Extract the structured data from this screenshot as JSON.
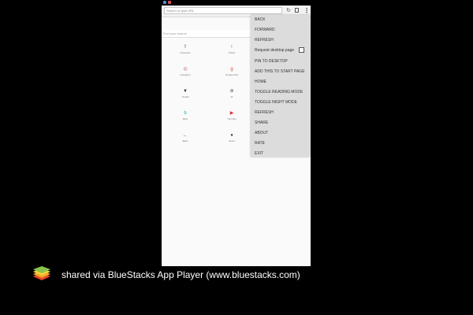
{
  "browser": {
    "url_placeholder": "Search or type URL",
    "search_placeholder": "Find your search",
    "icons": {
      "reload": "reload-icon",
      "tabs": "tabs-icon",
      "overflow": "overflow-menu-icon"
    }
  },
  "speed_dial": [
    {
      "icon": "facebook-icon",
      "label": "Facebook",
      "color": "#3b5998",
      "glyph": "f"
    },
    {
      "icon": "twitter-icon",
      "label": "Twitter",
      "color": "#55acee",
      "glyph": "t"
    },
    {
      "icon": "instagram-icon",
      "label": "Instagram",
      "color": "#c2507e",
      "glyph": "◎"
    },
    {
      "icon": "google-plus-icon",
      "label": "Google Plus",
      "color": "#dd4b39",
      "glyph": "g"
    },
    {
      "icon": "vivaldi-icon",
      "label": "Vivaldi",
      "color": "#333333",
      "glyph": "▼"
    },
    {
      "icon": "wikipedia-icon",
      "label": "W",
      "color": "#555555",
      "glyph": "⊛"
    },
    {
      "icon": "bing-icon",
      "label": "Bing",
      "color": "#2ba6a6",
      "glyph": "b"
    },
    {
      "icon": "youtube-icon",
      "label": "YouTube",
      "color": "#d9322f",
      "glyph": "▶"
    },
    {
      "icon": "back-arrow-icon",
      "label": "Back",
      "color": "#555555",
      "glyph": "←"
    },
    {
      "icon": "about-icon",
      "label": "About",
      "color": "#444444",
      "glyph": "●"
    }
  ],
  "menu": {
    "items": [
      "BACK",
      "FORWARD",
      "REFRESH",
      "Request desktop page",
      "PIN TO DESKTOP",
      "ADD THIS TO START PAGE",
      "HOME",
      "TOGGLE READING MODE",
      "TOGGLE NIGHT MODE",
      "REFRESH",
      "SHARE",
      "ABOUT",
      "RATE",
      "EXIT"
    ],
    "desktop_checkbox_checked": false
  },
  "footer": {
    "share_text": "shared via BlueStacks App Player (www.bluestacks.com)",
    "logo_icon": "bluestacks-logo-icon"
  }
}
